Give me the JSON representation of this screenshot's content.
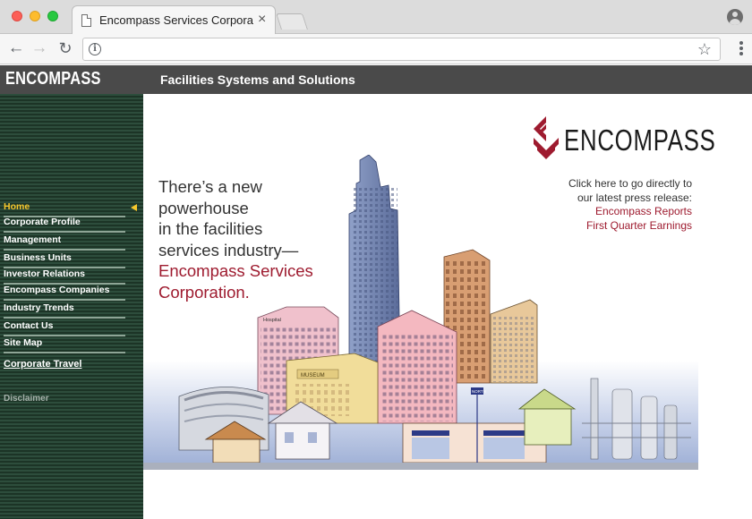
{
  "browser": {
    "tab_title": "Encompass Services Corporat",
    "tab_close_icon": "close-icon",
    "url": "",
    "icons": [
      "back-arrow-icon",
      "forward-arrow-icon",
      "reload-icon",
      "info-icon",
      "bookmark-star-icon",
      "menu-dots-icon",
      "profile-icon"
    ]
  },
  "header": {
    "logo": "ENCOMPASS",
    "tagline": "Facilities Systems and Solutions"
  },
  "sidebar": {
    "items": [
      {
        "label": "Home",
        "active": true
      },
      {
        "label": "Corporate Profile"
      },
      {
        "label": "Management"
      },
      {
        "label": "Business Units"
      },
      {
        "label": "Investor Relations"
      },
      {
        "label": "Encompass Companies"
      },
      {
        "label": "Industry Trends"
      },
      {
        "label": "Contact Us"
      },
      {
        "label": "Site Map"
      }
    ],
    "travel": "Corporate Travel",
    "disclaimer": "Disclaimer"
  },
  "content": {
    "brand_name": "ENCOMPASS",
    "headline": {
      "lines": [
        "There’s a new",
        "powerhouse",
        "in the facilities",
        "services industry—"
      ],
      "accent_lines": [
        "Encompass Services",
        "Corporation."
      ]
    },
    "press": {
      "intro_1": "Click here to go directly to",
      "intro_2": "our latest press release:",
      "link_1": "Encompass Reports",
      "link_2": "First Quarter Earnings"
    },
    "illustration": {
      "stadium_sign": "",
      "museum_sign": "MUSEUM",
      "tower_sign": "Hospital",
      "street_sign": "NORTH"
    }
  },
  "colors": {
    "accent": "#9e1b2f",
    "header_bg": "#4a4a4a",
    "sidebar_bg": "#1c3426",
    "active_nav": "#f7c72c"
  }
}
